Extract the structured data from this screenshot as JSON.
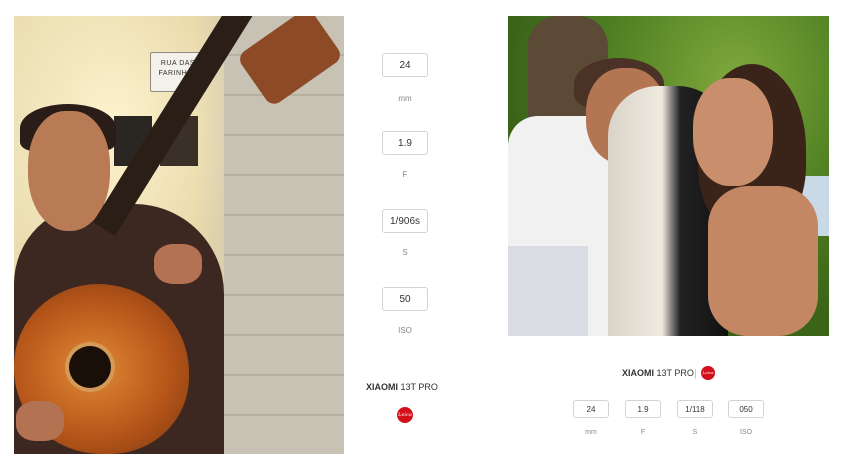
{
  "left_photo": {
    "street_sign": "RUA DAS FARINHAS"
  },
  "left_exif": {
    "items": [
      {
        "value": "24",
        "label": "mm"
      },
      {
        "value": "1.9",
        "label": "F"
      },
      {
        "value": "1/906s",
        "label": "S"
      },
      {
        "value": "50",
        "label": "ISO"
      }
    ],
    "brand": "XIAOMI",
    "model": "13T PRO",
    "logo": "Leica"
  },
  "right_exif": {
    "brand": "XIAOMI",
    "model": "13T PRO",
    "logo": "Leica",
    "items": [
      {
        "value": "24",
        "label": "mm"
      },
      {
        "value": "1.9",
        "label": "F"
      },
      {
        "value": "1/118",
        "label": "S"
      },
      {
        "value": "050",
        "label": "ISO"
      }
    ]
  },
  "colors": {
    "leica_red": "#d3101a",
    "box_border": "#d3d3d3",
    "label_gray": "#888888"
  }
}
